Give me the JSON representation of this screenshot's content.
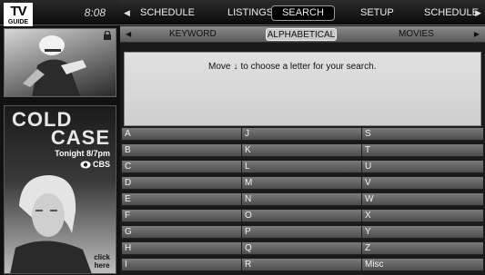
{
  "app": {
    "logo_line1": "TV",
    "logo_line2": "GUIDE",
    "clock": "8:08"
  },
  "top_nav": {
    "items": [
      "SCHEDULE",
      "LISTINGS",
      "SEARCH",
      "SETUP",
      "SCHEDULE"
    ],
    "selected": "SEARCH",
    "left_arrow": "◀",
    "right_arrow": "▶"
  },
  "sub_nav": {
    "items": [
      "KEYWORD",
      "ALPHABETICAL",
      "MOVIES"
    ],
    "selected": "ALPHABETICAL",
    "left_arrow": "◀",
    "right_arrow": "▶"
  },
  "message": {
    "prefix": "Move",
    "arrow": "↓",
    "suffix": "to choose a letter for your search."
  },
  "ad": {
    "title_line1": "COLD",
    "title_line2": "CASE",
    "time": "Tonight 8/7pm",
    "network": "CBS",
    "cta_line1": "click",
    "cta_line2": "here"
  },
  "letters": [
    [
      "A",
      "J",
      "S"
    ],
    [
      "B",
      "K",
      "T"
    ],
    [
      "C",
      "L",
      "U"
    ],
    [
      "D",
      "M",
      "V"
    ],
    [
      "E",
      "N",
      "W"
    ],
    [
      "F",
      "O",
      "X"
    ],
    [
      "G",
      "P",
      "Y"
    ],
    [
      "H",
      "Q",
      "Z"
    ],
    [
      "I",
      "R",
      "Misc"
    ]
  ],
  "icons": {
    "lock": "lock-icon",
    "network_logo": "cbs-eye-icon"
  },
  "colors": {
    "selected_tab_bg": "#000000",
    "grid_cell": "#6a6a6a",
    "message_bg": "#d8d8d8"
  }
}
